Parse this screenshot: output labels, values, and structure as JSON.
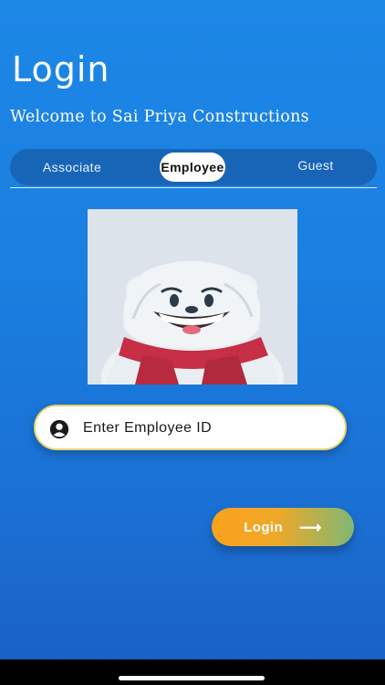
{
  "header": {
    "title": "Login",
    "subtitle": "Welcome to Sai Priya Constructions"
  },
  "tabs": [
    {
      "label": "Associate",
      "selected": false
    },
    {
      "label": "Employee",
      "selected": true
    },
    {
      "label": "Guest",
      "selected": false
    }
  ],
  "avatar": {
    "icon": "polar-bear-mascot"
  },
  "employee_input": {
    "placeholder": "Enter Employee ID",
    "value": "",
    "icon": "account-circle-icon"
  },
  "login_button": {
    "label": "Login",
    "icon": "arrow-right-icon",
    "arrow_glyph": "⟶"
  },
  "colors": {
    "background": "#1a7fe0",
    "tab_bar": "#1865b7",
    "button_orange": "#f9a21b",
    "button_green": "#7fb874",
    "input_border": "#e7d36c",
    "scarf": "#c62f45"
  }
}
